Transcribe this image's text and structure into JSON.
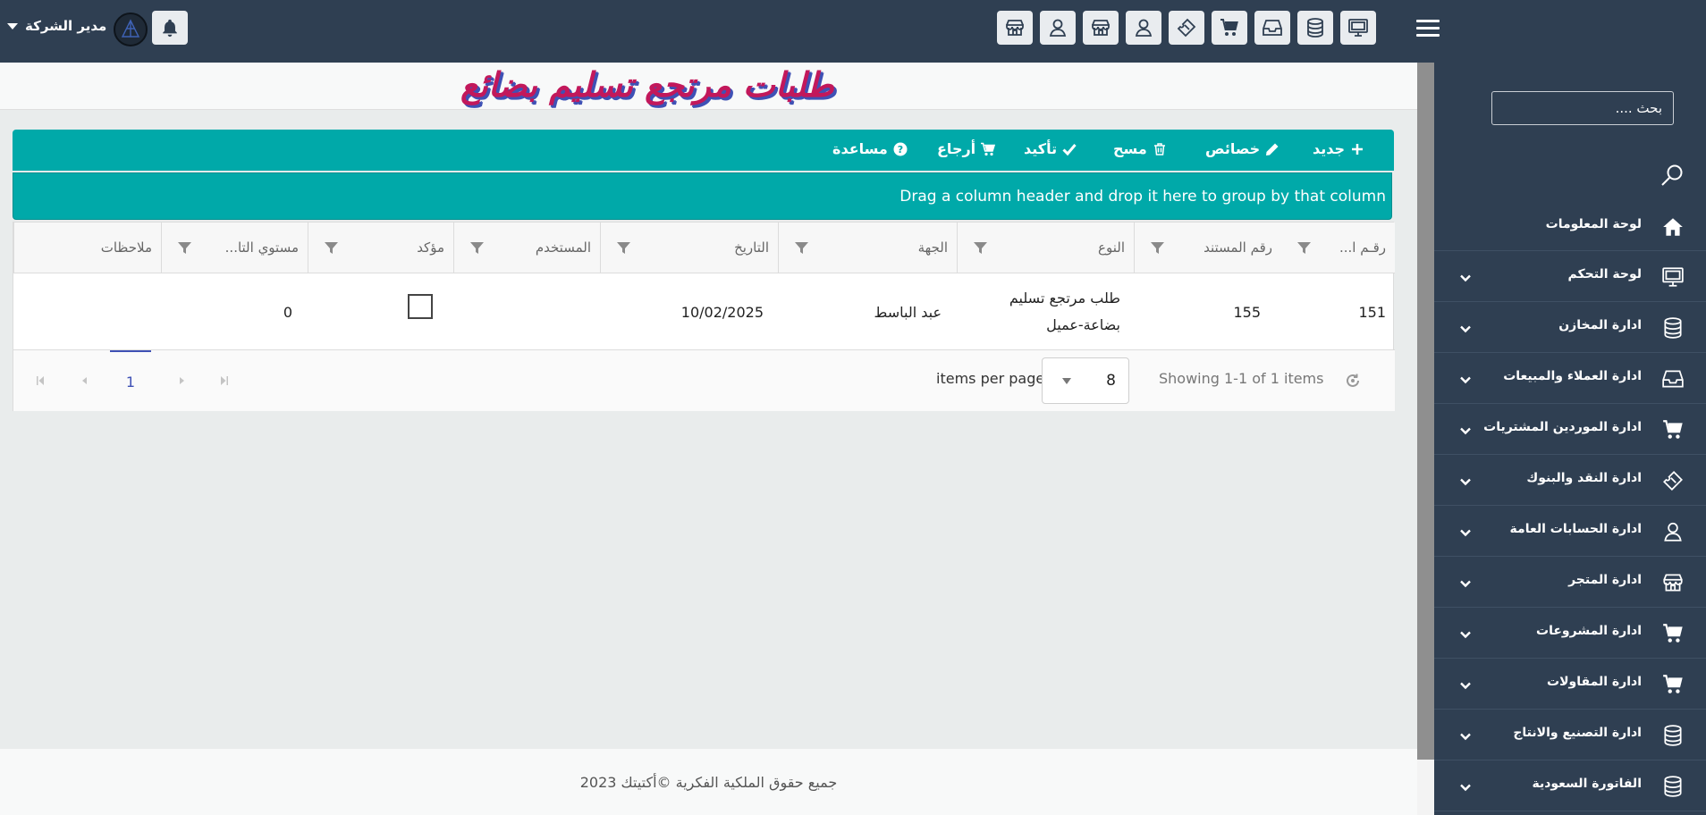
{
  "header": {
    "user_name": "مدير الشركة",
    "toolbar_icons": [
      "monitor-icon",
      "database-icon",
      "inbox-icon",
      "cart-icon",
      "ticket-icon",
      "user-icon",
      "store-icon",
      "user-icon",
      "store-icon"
    ]
  },
  "sidebar": {
    "search_placeholder": "بحث ....",
    "items": [
      {
        "label": "لوحة المعلومات",
        "icon": "home-icon"
      },
      {
        "label": "لوحة التحكم",
        "icon": "monitor-icon"
      },
      {
        "label": "ادارة المخازن",
        "icon": "database-icon"
      },
      {
        "label": "ادارة العملاء والمبيعات",
        "icon": "inbox-icon"
      },
      {
        "label": "ادارة الموردين المشتريات",
        "icon": "cart-icon"
      },
      {
        "label": "ادارة النقد والبنوك",
        "icon": "ticket-icon"
      },
      {
        "label": "ادارة الحسابات العامة",
        "icon": "user-icon"
      },
      {
        "label": "ادارة المتجر",
        "icon": "store-icon"
      },
      {
        "label": "ادارة المشروعات",
        "icon": "cart-icon"
      },
      {
        "label": "ادارة المقاولات",
        "icon": "cart-icon"
      },
      {
        "label": "ادارة التصنيع والانتاج",
        "icon": "database-icon"
      },
      {
        "label": "الفاتورة السعودية",
        "icon": "database-icon"
      }
    ]
  },
  "page": {
    "title": "طلبات مرتجع تسليم بضائع"
  },
  "toolbar": {
    "new": "جديد",
    "properties": "خصائص",
    "delete": "مسح",
    "confirm": "تأكيد",
    "return": "أرجاع",
    "help": "مساعدة"
  },
  "grid": {
    "group_hint": "Drag a column header and drop it here to group by that column",
    "columns": {
      "id": "رقـم ا...",
      "doc_no": "رقم المستند",
      "type": "النوع",
      "party": "الجهة",
      "date": "التاريخ",
      "user": "المستخدم",
      "confirmed": "مؤكد",
      "level": "مستوي التا...",
      "notes": "ملاحظات"
    },
    "rows": [
      {
        "id": "151",
        "doc_no": "155",
        "type_line1": "طلب مرتجع تسليم",
        "type_line2": "بضاعة-عميل",
        "party": "عبد الباسط",
        "date": "10/02/2025",
        "user": "",
        "confirmed": false,
        "level": "0",
        "notes": ""
      }
    ]
  },
  "pager": {
    "current_page": "1",
    "items_per_page_label": "items per page",
    "items_per_page": "8",
    "showing": "Showing 1-1 of 1 items"
  },
  "footer": {
    "copyright": "جميع حقوق الملكية الفكرية ©أكتيتك 2023"
  },
  "colors": {
    "topbar": "#2f3f52",
    "accent": "#00a9a9",
    "title": "#c2185b",
    "title_shadow": "#3f51b5"
  }
}
